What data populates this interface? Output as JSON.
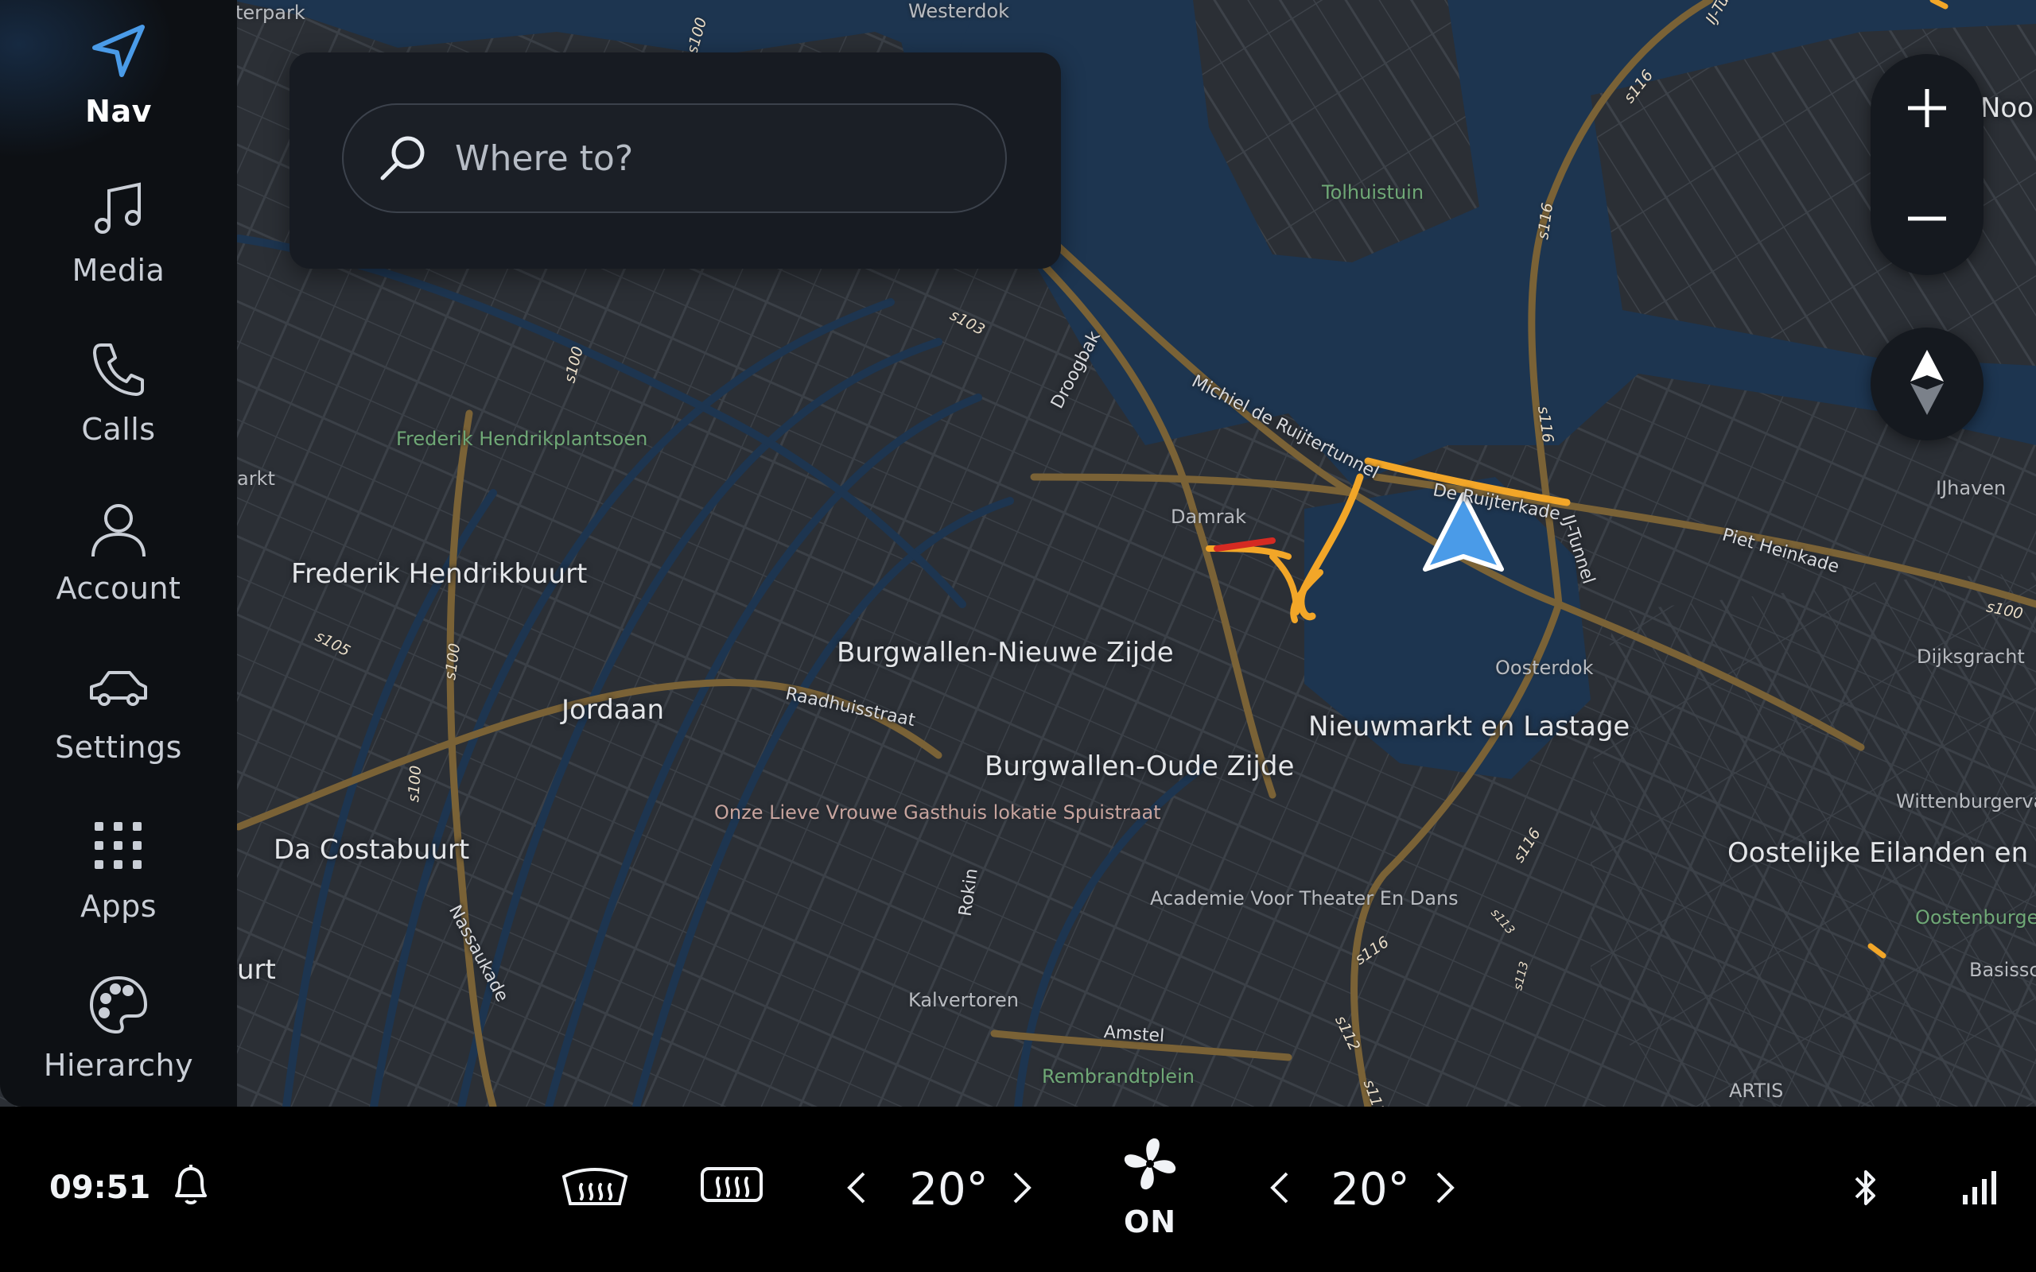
{
  "rail": {
    "items": [
      {
        "id": "nav",
        "label": "Nav",
        "icon": "navigation-arrow-icon",
        "active": true
      },
      {
        "id": "media",
        "label": "Media",
        "icon": "music-note-icon"
      },
      {
        "id": "calls",
        "label": "Calls",
        "icon": "phone-icon"
      },
      {
        "id": "account",
        "label": "Account",
        "icon": "person-icon"
      },
      {
        "id": "settings",
        "label": "Settings",
        "icon": "car-icon"
      },
      {
        "id": "apps",
        "label": "Apps",
        "icon": "grid-icon"
      },
      {
        "id": "hierarchy",
        "label": "Hierarchy",
        "icon": "palette-icon"
      }
    ]
  },
  "search": {
    "placeholder": "Where to?",
    "icon": "search-icon"
  },
  "map_controls": {
    "zoom_in": "zoom-in-icon",
    "zoom_out": "zoom-out-icon",
    "compass": "compass-icon"
  },
  "map": {
    "districts": [
      "Frederik Hendrikbuurt",
      "Jordaan",
      "Da Costabuurt",
      "Burgwallen-Nieuwe Zijde",
      "Burgwallen-Oude Zijde",
      "Nieuwmarkt en Lastage",
      "Oostelijke Eilanden en Kadij"
    ],
    "pois": [
      "Westerdok",
      "Damrak",
      "Oosterdok",
      "Kalvertoren",
      "IJhaven",
      "Dijksgracht",
      "Wittenburgervaart",
      "Basissch",
      "ARTIS",
      "Academie Voor Theater En Dans",
      "Onze Lieve Vrouwe Gasthuis lokatie Spuistraat"
    ],
    "parks": [
      "Tolhuistuin",
      "Frederik Hendrikplantsoen",
      "Rembrandtplein",
      "Oostenburgerp"
    ],
    "edge_labels": [
      "terpark",
      "arkt",
      "urt",
      "Noord"
    ],
    "streets": [
      "Michiel de Ruijtertunnel",
      "De Ruijterkade",
      "Piet Heinkade",
      "IJ-Tunnel",
      "Droogbak",
      "Raadhuisstraat",
      "Rokin",
      "Nassaukade",
      "Amstel"
    ],
    "road_numbers": [
      "s100",
      "s103",
      "s105",
      "s116",
      "s112",
      "s113",
      "IJ-Tu"
    ]
  },
  "bottom": {
    "time": "09:51",
    "notification_icon": "bell-icon",
    "defrost_front_icon": "front-defrost-icon",
    "defrost_rear_icon": "rear-defrost-icon",
    "left_temp": "20°",
    "right_temp": "20°",
    "fan_icon": "fan-icon",
    "fan_status": "ON",
    "bluetooth_icon": "bluetooth-icon",
    "signal_icon": "signal-bars-icon"
  },
  "colors": {
    "accent": "#4a9be8",
    "traffic_slow": "#f2a628",
    "traffic_jam": "#d52a22",
    "water": "#1d3550",
    "land": "#2b2f35"
  }
}
